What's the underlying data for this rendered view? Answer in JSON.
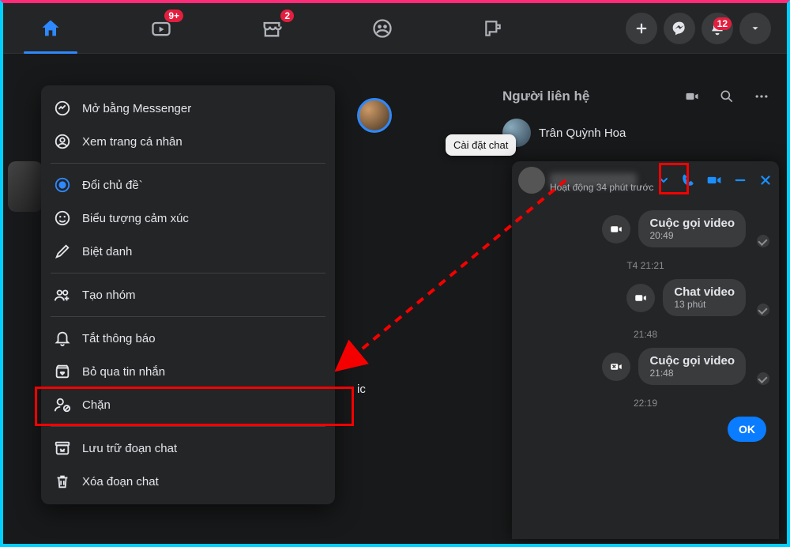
{
  "topnav": {
    "watch_badge": "9+",
    "market_badge": "2",
    "notif_badge": "12"
  },
  "contacts": {
    "title": "Người liên hệ",
    "person1": "Trân Quỳnh Hoa"
  },
  "tooltip": {
    "chat_settings": "Cài đặt chat"
  },
  "chat": {
    "status": "Hoạt động 34 phút trước",
    "msg1_title": "Cuộc gọi video",
    "msg1_time": "20:49",
    "sep1": "T4 21:21",
    "msg2_title": "Chat video",
    "msg2_time": "13 phút",
    "sep2": "21:48",
    "msg3_title": "Cuộc gọi video",
    "msg3_time": "21:48",
    "sep3": "22:19",
    "ok": "OK"
  },
  "menu": {
    "open_messenger": "Mở bằng Messenger",
    "view_profile": "Xem trang cá nhân",
    "change_theme": "Đổi chủ đề`",
    "emoji": "Biểu tượng cảm xúc",
    "nickname": "Biệt danh",
    "create_group": "Tạo nhóm",
    "mute": "Tắt thông báo",
    "ignore": "Bỏ qua tin nhắn",
    "block": "Chặn",
    "archive": "Lưu trữ đoạn chat",
    "delete": "Xóa đoạn chat"
  },
  "annotation": {
    "truncated": "ic"
  }
}
